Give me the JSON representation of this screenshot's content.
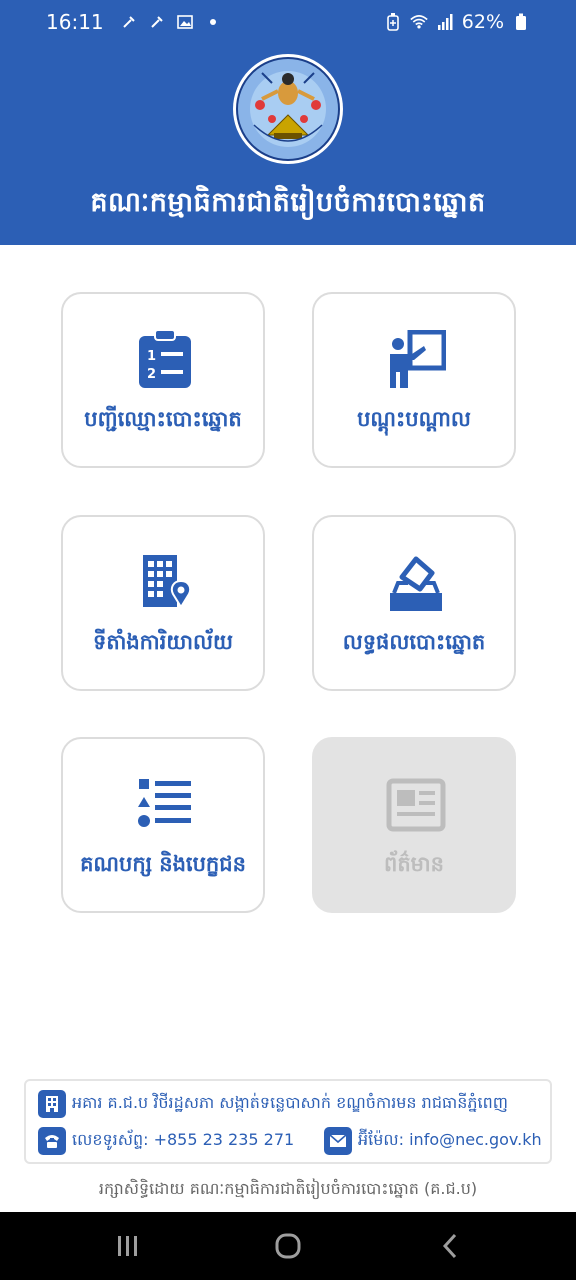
{
  "status_bar": {
    "time": "16:11",
    "battery": "62%",
    "left_icons": [
      "tool-icon",
      "tool-icon",
      "image-icon",
      "dot-icon"
    ],
    "right_icons": [
      "battery-saver-icon",
      "wifi-icon",
      "signal-icon",
      "battery-icon"
    ]
  },
  "header": {
    "title": "គណៈកម្មាធិការជាតិរៀបចំការបោះឆ្នោត",
    "logo": "nec-emblem-logo"
  },
  "menu": {
    "tiles": [
      {
        "label": "បញ្ជីឈ្មោះបោះឆ្នោត",
        "icon": "clipboard-list-icon",
        "enabled": true
      },
      {
        "label": "បណ្ដុះបណ្ដាល",
        "icon": "training-presenter-icon",
        "enabled": true
      },
      {
        "label": "ទីតាំងការិយាល័យ",
        "icon": "office-location-icon",
        "enabled": true
      },
      {
        "label": "លទ្ធផលបោះឆ្នោត",
        "icon": "ballot-box-icon",
        "enabled": true
      },
      {
        "label": "គណបក្ស និងបេក្ខជន",
        "icon": "list-shapes-icon",
        "enabled": true
      },
      {
        "label": "ព័ត៌មាន",
        "icon": "newspaper-icon",
        "enabled": false
      }
    ]
  },
  "footer": {
    "address": "អគារ គ.ជ.ប វិថីរដ្ឋសភា សង្កាត់ទន្លេបាសាក់ ខណ្ឌចំការមន រាជធានីភ្នំពេញ",
    "phone": "លេខទូរស័ព្ទ: +855 23 235 271",
    "email": "អ៊ីម៉ែល: info@nec.gov.kh",
    "copyright": "រក្សាសិទ្ធិដោយ គណៈកម្មាធិការជាតិរៀបចំការបោះឆ្នោត (គ.ជ.ប)"
  },
  "colors": {
    "primary": "#2c5fb5",
    "disabled_bg": "#e3e3e3",
    "disabled_fg": "#bdbdbd",
    "nav_bar": "#000000"
  },
  "nav_bar": {
    "buttons": [
      "recent-apps-icon",
      "home-icon",
      "back-icon"
    ]
  }
}
